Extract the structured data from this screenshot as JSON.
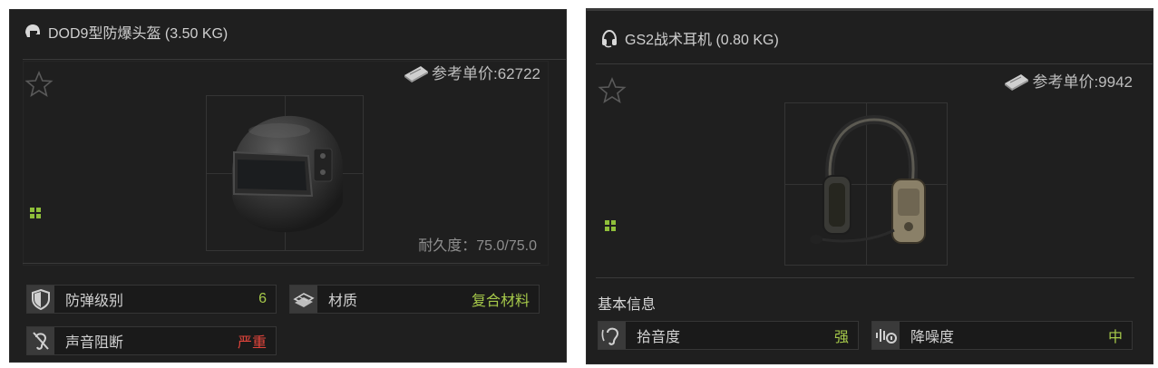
{
  "helmet": {
    "title": "DOD9型防爆头盔 (3.50 KG)",
    "price": "参考单价:62722",
    "durability": "耐久度：75.0/75.0",
    "stats": [
      {
        "label": "防弹级别",
        "value": "6",
        "value_color": "#a6c94a",
        "icon": "shield-icon"
      },
      {
        "label": "材质",
        "value": "复合材料",
        "value_color": "#a6c94a",
        "icon": "material-icon"
      },
      {
        "label": "声音阻断",
        "value": "严重",
        "value_color": "#e0443b",
        "icon": "ear-blocked-icon"
      }
    ]
  },
  "headset": {
    "title": "GS2战术耳机 (0.80 KG)",
    "price": "参考单价:9942",
    "section_title": "基本信息",
    "stats": [
      {
        "label": "拾音度",
        "value": "强",
        "value_color": "#a6c94a",
        "icon": "ear-icon"
      },
      {
        "label": "降噪度",
        "value": "中",
        "value_color": "#a6c94a",
        "icon": "noise-reduction-icon"
      }
    ]
  },
  "colors": {
    "panel_bg": "#1f1f1f",
    "accent_green": "#a6c94a",
    "danger_red": "#e0443b",
    "grid_icon_green": "#8fbf3a"
  }
}
